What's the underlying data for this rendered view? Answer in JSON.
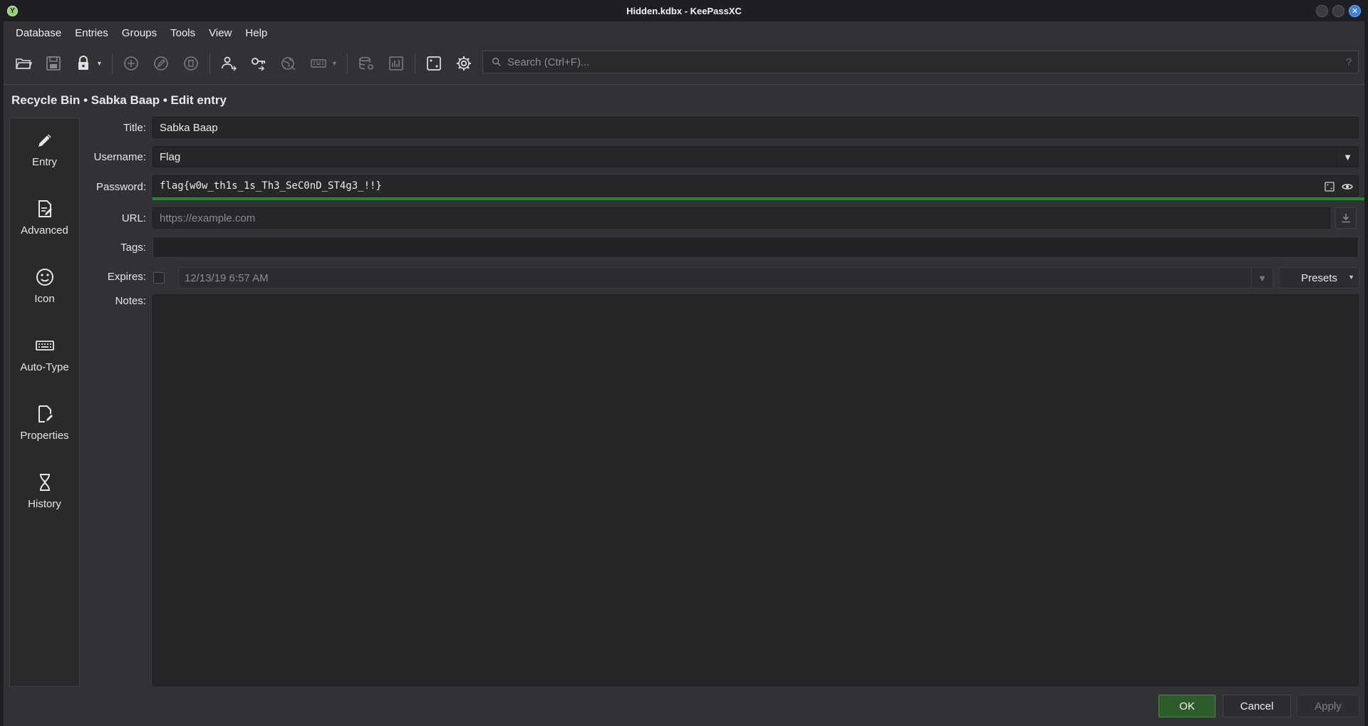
{
  "window": {
    "title": "Hidden.kdbx - KeePassXC",
    "app_icon_glyph": "Y"
  },
  "menubar": [
    "Database",
    "Entries",
    "Groups",
    "Tools",
    "View",
    "Help"
  ],
  "toolbar": {
    "search_placeholder": "Search (Ctrl+F)...",
    "search_help": "?",
    "icons": [
      "open-folder-icon",
      "save-icon",
      "lock-icon",
      "add-entry-icon",
      "edit-entry-icon",
      "delete-entry-icon",
      "copy-username-icon",
      "copy-password-icon",
      "open-url-icon",
      "autotype-keyboard-icon",
      "database-settings-icon",
      "reports-icon",
      "password-generator-icon",
      "settings-gear-icon"
    ]
  },
  "breadcrumb": "Recycle Bin • Sabka Baap • Edit entry",
  "side_nav": [
    {
      "label": "Entry",
      "icon": "pencil-icon"
    },
    {
      "label": "Advanced",
      "icon": "document-edit-icon"
    },
    {
      "label": "Icon",
      "icon": "smiley-icon"
    },
    {
      "label": "Auto-Type",
      "icon": "keyboard-icon"
    },
    {
      "label": "Properties",
      "icon": "file-properties-icon"
    },
    {
      "label": "History",
      "icon": "hourglass-icon"
    }
  ],
  "form": {
    "title_label": "Title:",
    "title_value": "Sabka Baap",
    "username_label": "Username:",
    "username_value": "Flag",
    "password_label": "Password:",
    "password_value": "flag{w0w_th1s_1s_Th3_SeC0nD_ST4g3_!!}",
    "password_strength": 1.0,
    "url_label": "URL:",
    "url_placeholder": "https://example.com",
    "tags_label": "Tags:",
    "tags_value": "",
    "expires_label": "Expires:",
    "expires_checked": false,
    "expires_value": "12/13/19 6:57 AM",
    "presets_label": "Presets",
    "notes_label": "Notes:",
    "notes_value": ""
  },
  "buttons": {
    "ok": "OK",
    "cancel": "Cancel",
    "apply": "Apply"
  },
  "colors": {
    "accent_green": "#1f8a2a",
    "ok_button": "#2c5b2c",
    "close_button": "#3d7fe0"
  }
}
